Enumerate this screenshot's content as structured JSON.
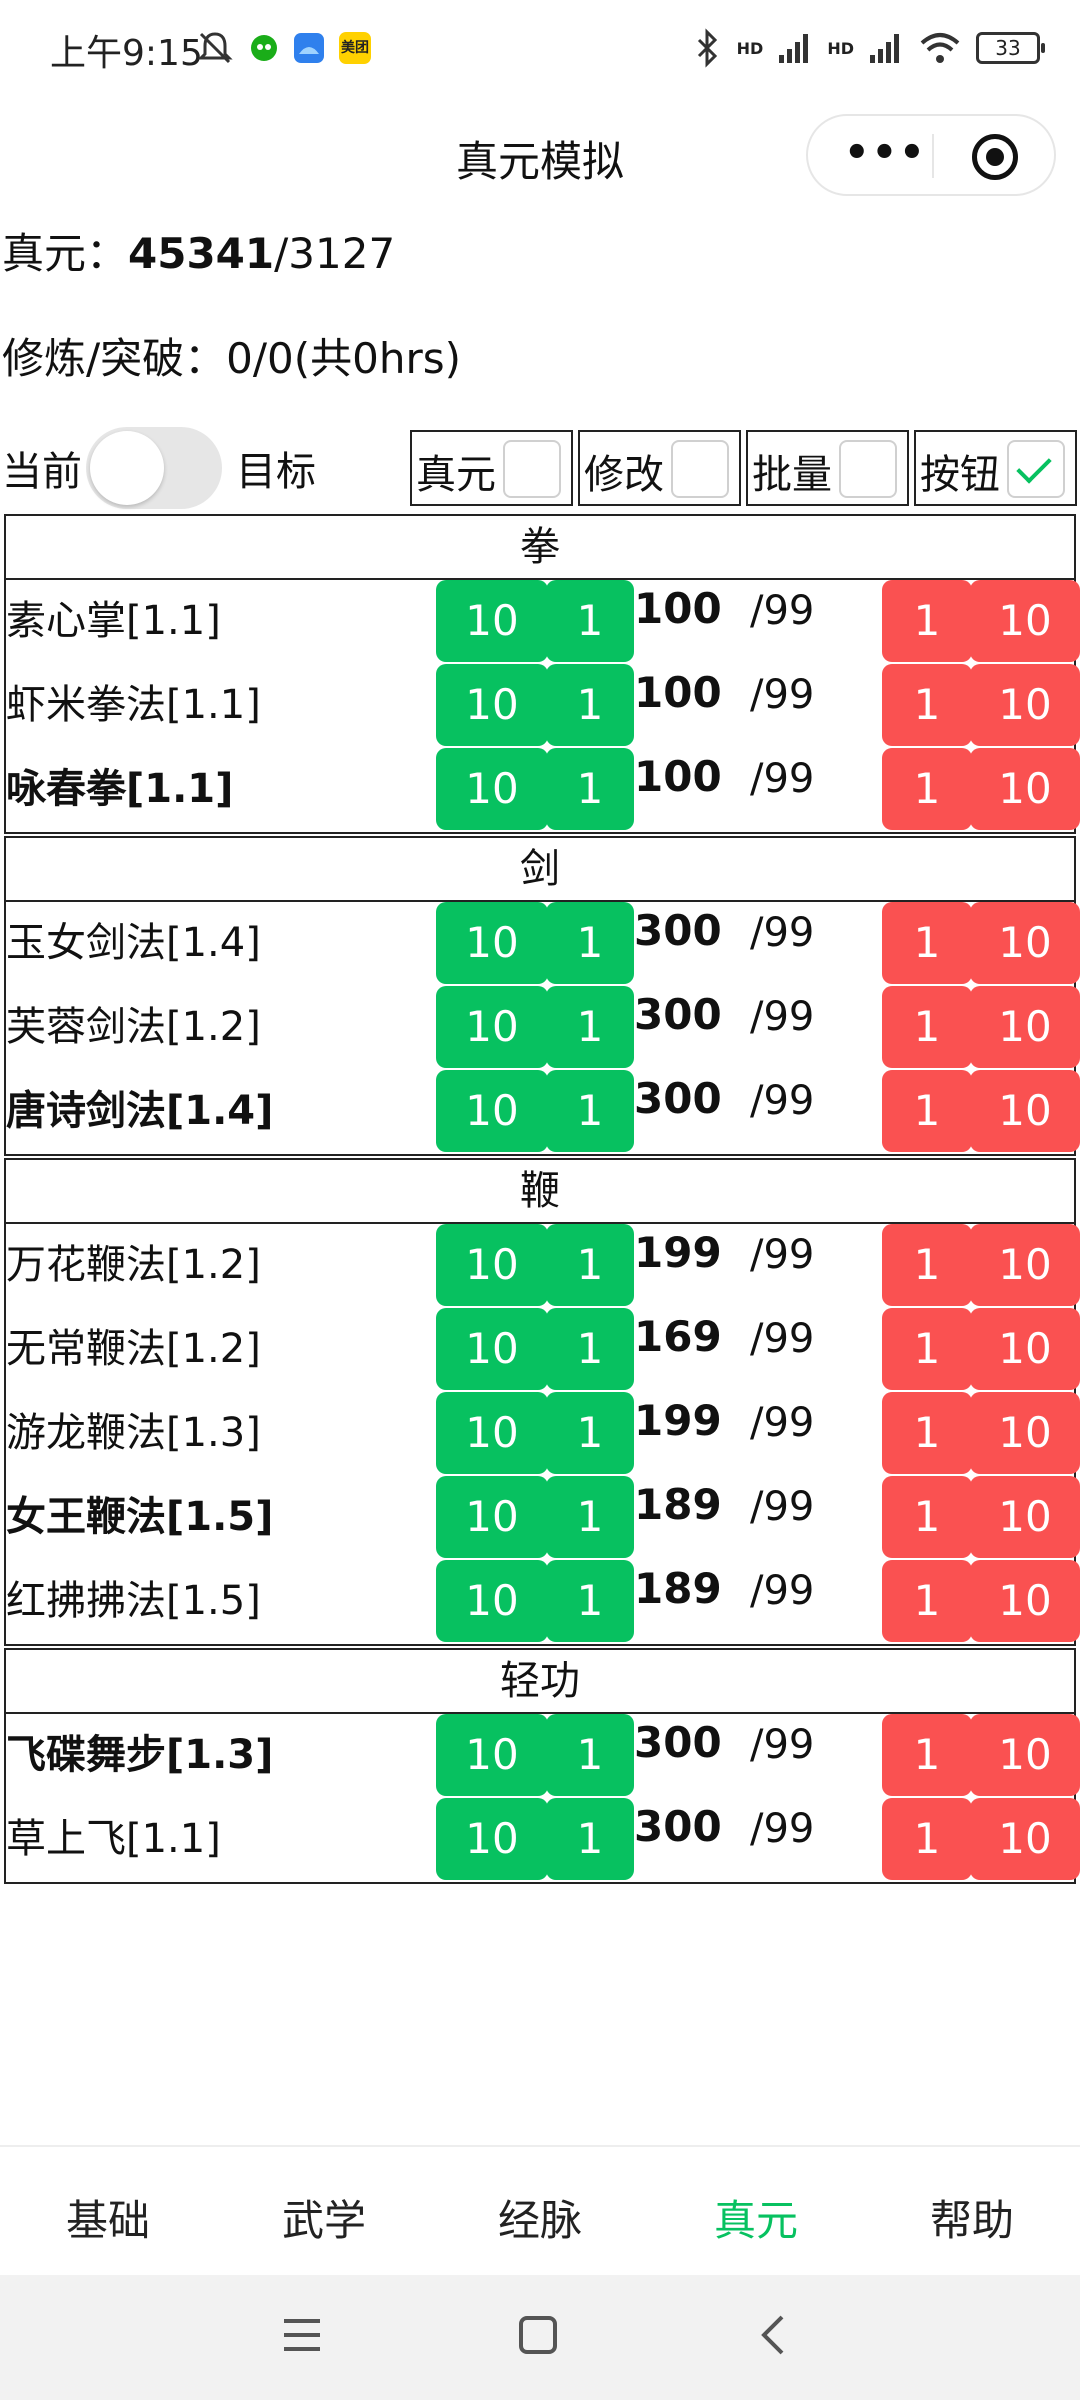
{
  "status": {
    "time": "上午9:15",
    "battery": "33",
    "hd1": "HD",
    "hd2": "HD",
    "meituan": "美团"
  },
  "nav": {
    "title": "真元模拟"
  },
  "summary": {
    "label": "真元：",
    "current": "45341",
    "rest": "/3127",
    "cultivation": "修炼/突破：0/0(共0hrs)"
  },
  "controls": {
    "current_label": "当前",
    "target_label": "目标",
    "checks": [
      {
        "label": "真元",
        "checked": false
      },
      {
        "label": "修改",
        "checked": false
      },
      {
        "label": "批量",
        "checked": false
      },
      {
        "label": "按钮",
        "checked": true
      }
    ]
  },
  "buttons": {
    "green_big": "10",
    "green_small": "1",
    "red_small": "1",
    "red_big": "10"
  },
  "sections": [
    {
      "title": "拳",
      "rows": [
        {
          "name": "素心掌[1.1]",
          "bold": false,
          "value": "100",
          "max": "/99"
        },
        {
          "name": "虾米拳法[1.1]",
          "bold": false,
          "value": "100",
          "max": "/99"
        },
        {
          "name": "咏春拳[1.1]",
          "bold": true,
          "value": "100",
          "max": "/99"
        }
      ]
    },
    {
      "title": "剑",
      "rows": [
        {
          "name": "玉女剑法[1.4]",
          "bold": false,
          "value": "300",
          "max": "/99"
        },
        {
          "name": "芙蓉剑法[1.2]",
          "bold": false,
          "value": "300",
          "max": "/99"
        },
        {
          "name": "唐诗剑法[1.4]",
          "bold": true,
          "value": "300",
          "max": "/99"
        }
      ]
    },
    {
      "title": "鞭",
      "rows": [
        {
          "name": "万花鞭法[1.2]",
          "bold": false,
          "value": "199",
          "max": "/99"
        },
        {
          "name": "无常鞭法[1.2]",
          "bold": false,
          "value": "169",
          "max": "/99"
        },
        {
          "name": "游龙鞭法[1.3]",
          "bold": false,
          "value": "199",
          "max": "/99"
        },
        {
          "name": "女王鞭法[1.5]",
          "bold": true,
          "value": "189",
          "max": "/99"
        },
        {
          "name": "红拂拂法[1.5]",
          "bold": false,
          "value": "189",
          "max": "/99"
        }
      ]
    },
    {
      "title": "轻功",
      "rows": [
        {
          "name": "飞碟舞步[1.3]",
          "bold": true,
          "value": "300",
          "max": "/99"
        },
        {
          "name": "草上飞[1.1]",
          "bold": false,
          "value": "300",
          "max": "/99"
        }
      ]
    }
  ],
  "tabs": [
    {
      "label": "基础",
      "active": false
    },
    {
      "label": "武学",
      "active": false
    },
    {
      "label": "经脉",
      "active": false
    },
    {
      "label": "真元",
      "active": true
    },
    {
      "label": "帮助",
      "active": false
    }
  ],
  "colors": {
    "green": "#07c160",
    "red": "#fa5151"
  }
}
